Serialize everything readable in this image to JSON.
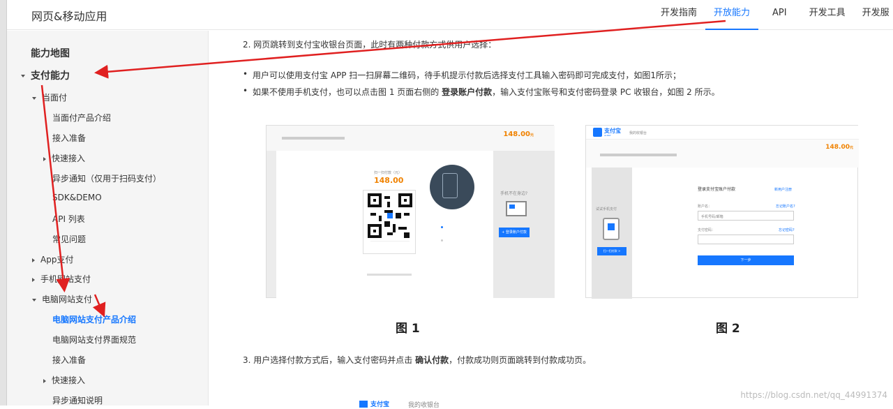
{
  "header": {
    "site_title": "网页&移动应用",
    "nav": [
      "开发指南",
      "开放能力",
      "API",
      "开发工具",
      "开发服"
    ],
    "active_nav": "开放能力"
  },
  "sidebar": {
    "map": "能力地图",
    "pay": "支付能力",
    "items": {
      "face_pay": "当面付",
      "face_pay_intro": "当面付产品介绍",
      "face_pay_prep": "接入准备",
      "face_pay_quick": "快速接入",
      "face_pay_async": "异步通知（仅用于扫码支付）",
      "face_pay_sdk": "SDK&DEMO",
      "face_pay_api": "API 列表",
      "face_pay_faq": "常见问题",
      "app_pay": "App支付",
      "mobile_pay": "手机网站支付",
      "pc_pay": "电脑网站支付",
      "pc_pay_intro": "电脑网站支付产品介绍",
      "pc_pay_ui": "电脑网站支付界面规范",
      "pc_pay_prep": "接入准备",
      "pc_pay_quick": "快速接入",
      "pc_pay_async": "异步通知说明"
    }
  },
  "content": {
    "step2": "2. 网页跳转到支付宝收银台页面，此时有两种付款方式供用户选择：",
    "bullet1": "用户可以使用支付宝 APP 扫一扫屏幕二维码，待手机提示付款后选择支付工具输入密码即可完成支付，如图1所示；",
    "bullet2_a": "如果不使用手机支付，也可以点击图 1 页面右侧的 ",
    "bullet2_b": "登录账户付款",
    "bullet2_c": "，输入支付宝账号和支付密码登录 PC 收银台，如图 2 所示。",
    "fig1_caption": "图 1",
    "fig2_caption": "图 2",
    "step3_a": "3. 用户选择付款方式后，输入支付密码并点击 ",
    "step3_b": "确认付款",
    "step3_c": "，付款成功则页面跳转到付款成功页。",
    "watermark": "https://blog.csdn.net/qq_44991374"
  },
  "fig1": {
    "amount": "148.00",
    "amount_unit": "元",
    "scan_label": "扫一扫付款（元）",
    "no_phone": "手机不在身边?",
    "login_btn": "+ 登录账户付款"
  },
  "fig2": {
    "logo": "支付宝",
    "logo_en": "ALIPAY",
    "cashier": "我的收银台",
    "amount": "148.00",
    "amount_unit": "元",
    "try_phone": "试试手机支付",
    "scan_btn": "扫一扫付款 >",
    "login_title": "登录支付宝账户付款",
    "register": "新用户注册",
    "account_label": "账户名：",
    "forgot_account": "忘记账户名?",
    "account_placeholder": "手机号码/邮箱",
    "pwd_label": "支付密码：",
    "forgot_pwd": "忘记密码?",
    "next_btn": "下一步"
  },
  "colors": {
    "accent": "#1677ff",
    "annotation": "#e02020",
    "sidebar_bg": "#f5f5f5",
    "amount": "#f08200"
  }
}
